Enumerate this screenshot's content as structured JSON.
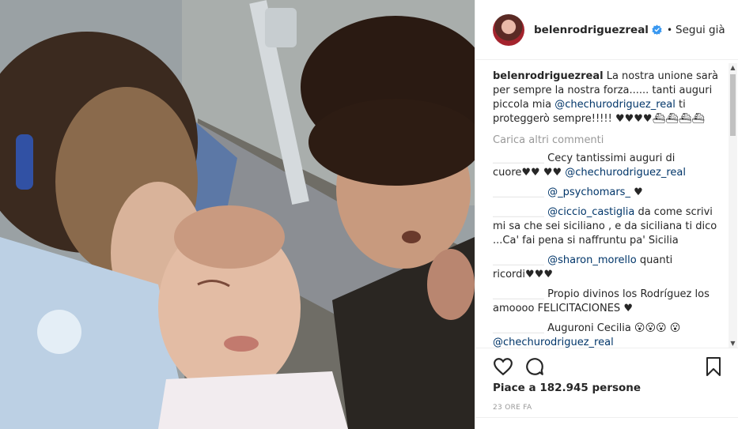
{
  "photo": {
    "alt_icon": "baby-photo"
  },
  "header": {
    "username": "belenrodriguezreal",
    "verified_icon": "verified-badge-icon",
    "separator": "•",
    "follow_label": "Segui già"
  },
  "caption": {
    "username": "belenrodriguezreal",
    "text_before": " La nostra unione sarà per sempre la nostra forza...... tanti auguri piccola mia ",
    "mention": "@chechurodriguez_real",
    "text_after": " ti proteggerò sempre!!!!! ♥♥♥♥⛴⛴⛴⛴"
  },
  "load_more": "Carica altri commenti",
  "comments": [
    {
      "user": "__________",
      "before": "Cecy tantissimi auguri di cuore♥♥ ♥♥ ",
      "mention": "@chechurodriguez_real",
      "after": ""
    },
    {
      "user": "__________",
      "before": "",
      "mention": "@_psychomars_",
      "after": " ♥"
    },
    {
      "user": "__________",
      "before": "",
      "mention": "@ciccio_castiglia",
      "after": " da come scrivi mi sa che sei siciliano , e da siciliana ti dico ...Ca' fai pena si naffruntu pa' Sicilia"
    },
    {
      "user": "__________",
      "before": "",
      "mention": "@sharon_morello",
      "after": " quanti ricordi♥♥♥"
    },
    {
      "user": "__________",
      "before": "Propio divinos los Rodríguez los amoooo FELICITACIONES ♥",
      "mention": "",
      "after": ""
    },
    {
      "user": "__________",
      "before": "Auguroni Cecilia 😮😮😮 😮 ",
      "mention": "@chechurodriguez_real",
      "after": ""
    }
  ],
  "actions": {
    "like_icon": "heart-icon",
    "comment_icon": "comment-icon",
    "save_icon": "bookmark-icon"
  },
  "likes": {
    "prefix": "Piace a ",
    "count": "182.945",
    "suffix": " persone"
  },
  "timestamp": "23 ORE FA",
  "colors": {
    "mention": "#003569",
    "verified": "#3897f0",
    "muted": "#999999"
  }
}
